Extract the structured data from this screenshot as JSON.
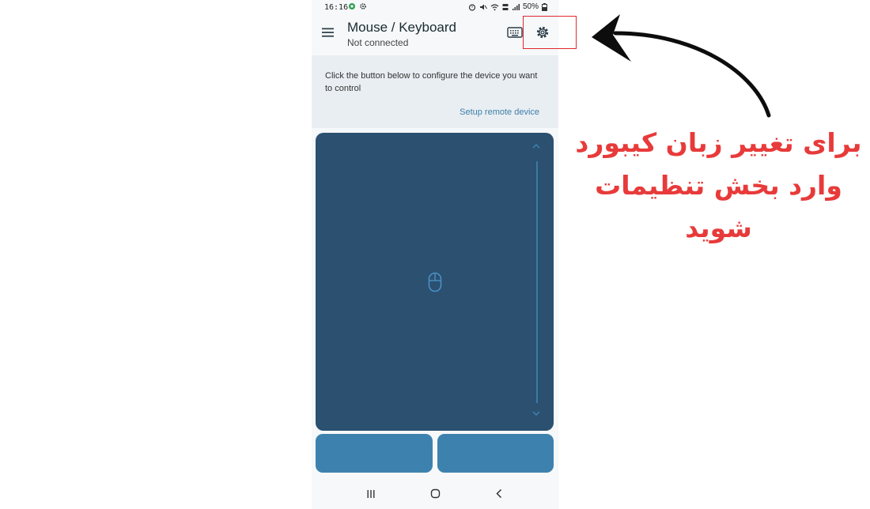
{
  "statusbar": {
    "time": "16:16",
    "battery": "50%"
  },
  "appbar": {
    "title": "Mouse / Keyboard",
    "subtitle": "Not connected",
    "menu_icon": "hamburger-menu-icon",
    "keyboard_icon": "keyboard-icon",
    "settings_icon": "gear-icon"
  },
  "info_card": {
    "message": "Click the button below to configure the device you want to control",
    "link": "Setup remote device"
  },
  "touchpad": {
    "center_icon": "mouse-icon",
    "scroll_up_icon": "chevron-up-icon",
    "scroll_down_icon": "chevron-down-icon"
  },
  "mouse_buttons": [
    "left-click",
    "right-click"
  ],
  "navbar": {
    "icons": [
      "recents-icon",
      "home-icon",
      "back-icon"
    ]
  },
  "annotation": {
    "lines": [
      "برای تغییر زبان کیبورد",
      "وارد بخش تنظیمات",
      "شوید"
    ]
  },
  "colors": {
    "touchpad_bg": "#2b5070",
    "mouse_button_bg": "#3d82ae",
    "annotation_text": "#e83a3a",
    "highlight_box": "#e0282e",
    "link": "#3d7fa8"
  }
}
